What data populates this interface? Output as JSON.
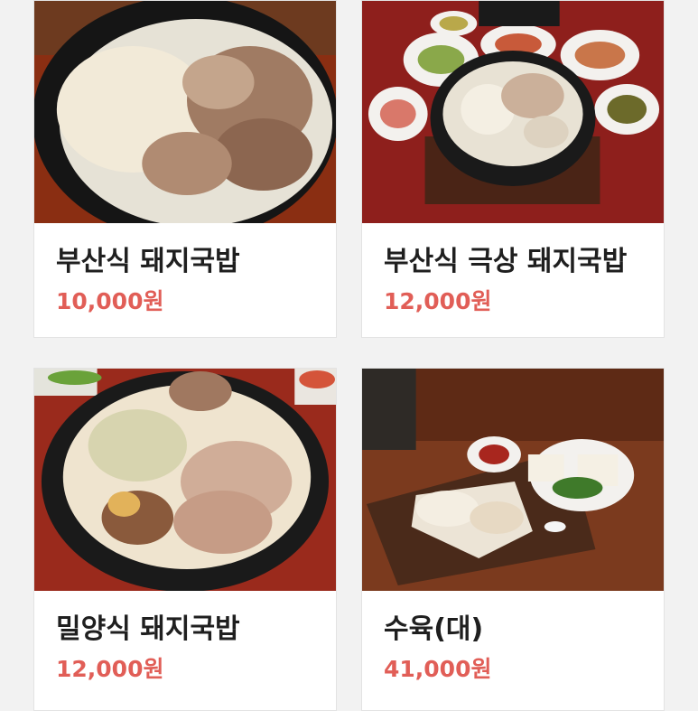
{
  "menu": {
    "items": [
      {
        "name": "부산식 돼지국밥",
        "price": "10,000원",
        "image_icon": "busan-pork-soup-photo"
      },
      {
        "name": "부산식 극상 돼지국밥",
        "price": "12,000원",
        "image_icon": "busan-premium-pork-soup-photo"
      },
      {
        "name": "밀양식 돼지국밥",
        "price": "12,000원",
        "image_icon": "miryang-pork-soup-photo"
      },
      {
        "name": "수육(대)",
        "price": "41,000원",
        "image_icon": "boiled-pork-platter-photo"
      }
    ]
  },
  "colors": {
    "price": "#e15e57",
    "name": "#1f1f1f",
    "card_border": "#e3e3e3"
  }
}
